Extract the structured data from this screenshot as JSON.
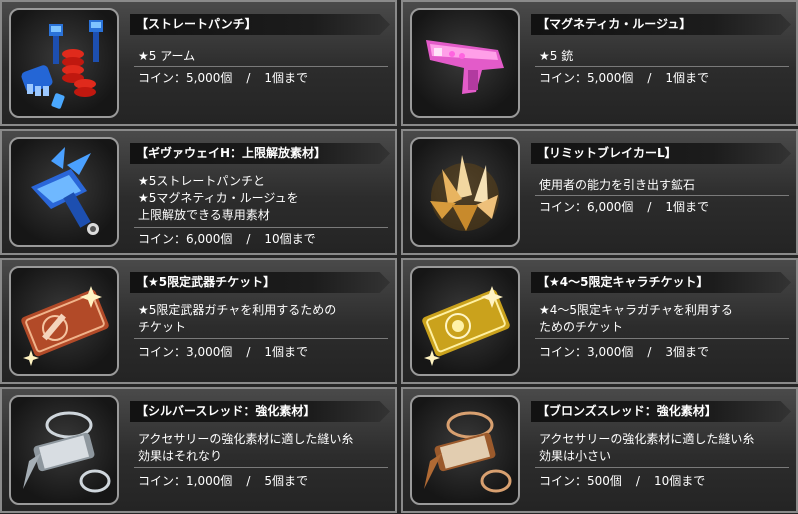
{
  "items": [
    {
      "title": "【ストレートパンチ】",
      "desc": "★5 アーム",
      "price": "コイン：5,000個",
      "limit": "1個まで",
      "icon": "robot-fist-weapon-icon"
    },
    {
      "title": "【マグネティカ・ルージュ】",
      "desc": "★5 銃",
      "price": "コイン：5,000個",
      "limit": "1個まで",
      "icon": "pink-gun-icon"
    },
    {
      "title": "【ギヴァウェイH：上限解放素材】",
      "desc": "★5ストレートパンチと\n★5マグネティカ・ルージュを\n上限解放できる専用素材",
      "price": "コイン：6,000個",
      "limit": "10個まで",
      "icon": "blue-claw-material-icon"
    },
    {
      "title": "【リミットブレイカーL】",
      "desc": "使用者の能力を引き出す鉱石",
      "price": "コイン：6,000個",
      "limit": "1個まで",
      "icon": "crystal-ore-icon"
    },
    {
      "title": "【★5限定武器チケット】",
      "desc": "★5限定武器ガチャを利用するための\nチケット",
      "price": "コイン：3,000個",
      "limit": "1個まで",
      "icon": "weapon-ticket-icon"
    },
    {
      "title": "【★4～5限定キャラチケット】",
      "desc": "★4～5限定キャラガチャを利用する\nためのチケット",
      "price": "コイン：3,000個",
      "limit": "3個まで",
      "icon": "character-ticket-icon"
    },
    {
      "title": "【シルバースレッド：強化素材】",
      "desc": "アクセサリーの強化素材に適した縫い糸\n効果はそれなり",
      "price": "コイン：1,000個",
      "limit": "5個まで",
      "icon": "silver-thread-spool-icon"
    },
    {
      "title": "【ブロンズスレッド：強化素材】",
      "desc": "アクセサリーの強化素材に適した縫い糸\n効果は小さい",
      "price": "コイン：500個",
      "limit": "10個まで",
      "icon": "bronze-thread-spool-icon"
    }
  ],
  "slash": "/",
  "colors": {
    "panel": "#3a3a3a",
    "border": "#8a8a8a",
    "title_bg": "#161616"
  }
}
